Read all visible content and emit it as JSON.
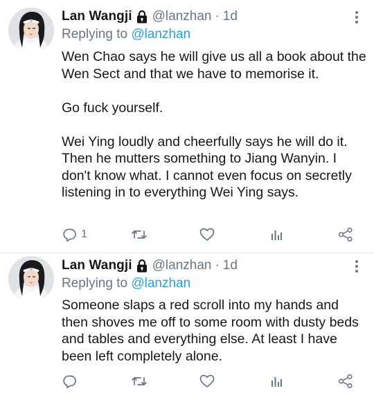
{
  "tweets": [
    {
      "author_name": "Lan Wangji",
      "handle": "@lanzhan",
      "separator": "·",
      "time": "1d",
      "replying_to_prefix": "Replying to",
      "replying_to_mention": "@lanzhan",
      "paragraphs": [
        "Wen Chao says he will give us all a book about the Wen Sect and that we have to memorise it.",
        "Go fuck yourself.",
        "Wei Ying loudly and cheerfully says he will do it. Then he mutters something to Jiang Wanyin. I don't know what. I cannot even focus on secretly listening in to everything Wei Ying says."
      ],
      "reply_count": "1"
    },
    {
      "author_name": "Lan Wangji",
      "handle": "@lanzhan",
      "separator": "·",
      "time": "1d",
      "replying_to_prefix": "Replying to",
      "replying_to_mention": "@lanzhan",
      "paragraphs": [
        "Someone slaps a red scroll into my hands and then shoves me off to some room with dusty beds and tables and everything else. At least I have been left completely alone."
      ],
      "reply_count": ""
    }
  ],
  "icons": {
    "lock": "lock-icon",
    "more": "more-vertical-icon",
    "reply": "reply-icon",
    "retweet": "retweet-icon",
    "like": "heart-icon",
    "analytics": "analytics-icon",
    "share": "share-icon"
  },
  "colors": {
    "text": "#14171a",
    "secondary": "#657786",
    "link": "#1da1f2",
    "divider": "#e6ecf0"
  }
}
